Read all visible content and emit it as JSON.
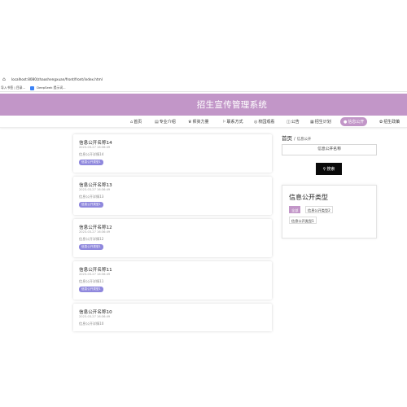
{
  "browser": {
    "url": "localhost:8080/zhaoshengxuan/front/front/index.html",
    "bookmarks": [
      "导入书签 | 目录...",
      "DeepSeek 提示词..."
    ]
  },
  "header": {
    "title": "招生宣传管理系统"
  },
  "nav": {
    "items": [
      {
        "label": "首页"
      },
      {
        "label": "专业介绍"
      },
      {
        "label": "师资力量"
      },
      {
        "label": "联系方式"
      },
      {
        "label": "校园观看"
      },
      {
        "label": "公告"
      },
      {
        "label": "招生计划"
      },
      {
        "label": "信息公开"
      },
      {
        "label": "招生政策"
      }
    ],
    "active_index": 7,
    "accent_color": "#c296c8"
  },
  "list": [
    {
      "title": "信息公开名称14",
      "date": "2023-03-27 16:36:49",
      "summary": "信息公开详情14",
      "tag": "信息公开类型1"
    },
    {
      "title": "信息公开名称13",
      "date": "2023-03-27 16:36:49",
      "summary": "信息公开详情13",
      "tag": "信息公开类型1"
    },
    {
      "title": "信息公开名称12",
      "date": "2023-03-27 16:36:49",
      "summary": "信息公开详情12",
      "tag": "信息公开类型1"
    },
    {
      "title": "信息公开名称11",
      "date": "2023-03-27 16:36:49",
      "summary": "信息公开详情11",
      "tag": "信息公开类型1"
    },
    {
      "title": "信息公开名称10",
      "date": "2023-03-27 16:36:49",
      "summary": "信息公开详情10",
      "tag": ""
    }
  ],
  "sidebar": {
    "breadcrumb_home": "首页",
    "breadcrumb_sep": "/",
    "breadcrumb_current": "信息公开",
    "search_placeholder": "信息公开名称",
    "search_label": "搜索",
    "category_title": "信息公开类型",
    "categories": [
      "全部",
      "信息公开类型2",
      "信息公开类型1"
    ]
  },
  "icons": [
    "home-icon",
    "book-icon",
    "faculty-icon",
    "flag-icon",
    "globe-icon",
    "announce-icon",
    "calendar-icon",
    "info-icon",
    "policy-icon",
    "search-icon"
  ]
}
